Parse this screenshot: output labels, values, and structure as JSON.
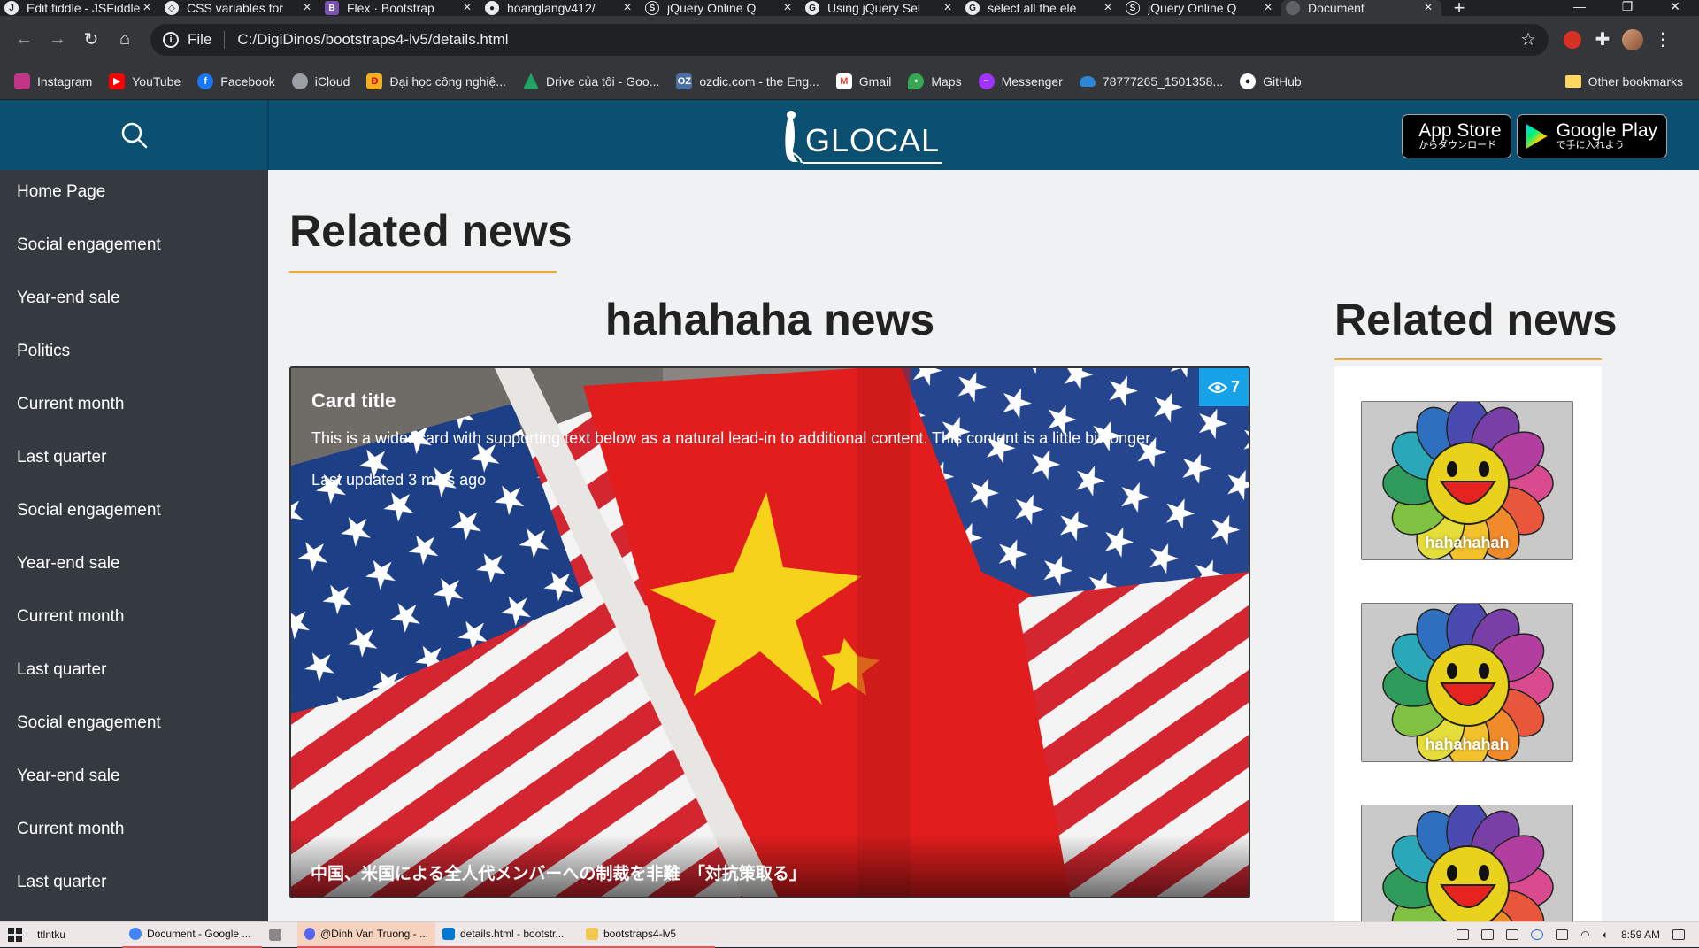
{
  "browser": {
    "tabs": [
      {
        "title": "Edit fiddle - JSFiddle",
        "icon": "jsfiddle-icon"
      },
      {
        "title": "CSS variables for",
        "icon": "codepen-icon"
      },
      {
        "title": "Flex · Bootstrap",
        "icon": "bootstrap-icon"
      },
      {
        "title": "hoanglangv412/",
        "icon": "github-icon"
      },
      {
        "title": "jQuery Online Q",
        "icon": "site-icon"
      },
      {
        "title": "Using jQuery Sel",
        "icon": "google-icon"
      },
      {
        "title": "select all the ele",
        "icon": "google-icon"
      },
      {
        "title": "jQuery Online Q",
        "icon": "site-icon"
      },
      {
        "title": "Document",
        "icon": "globe-icon",
        "active": true
      }
    ],
    "address": {
      "scheme": "File",
      "url": "C:/DigiDinos/bootstraps4-lv5/details.html"
    },
    "bookmarks": [
      {
        "label": "Instagram",
        "color": "#c13584"
      },
      {
        "label": "YouTube",
        "color": "#ff0000"
      },
      {
        "label": "Facebook",
        "color": "#1877f2"
      },
      {
        "label": "iCloud",
        "color": "#9aa0a6"
      },
      {
        "label": "Đại học công nghiệ...",
        "color": "#f2b01e"
      },
      {
        "label": "Drive của tôi - Goo...",
        "color": "#1fa463"
      },
      {
        "label": "ozdic.com - the Eng...",
        "color": "#4a6fa5"
      },
      {
        "label": "Gmail",
        "color": "#ea4335"
      },
      {
        "label": "Maps",
        "color": "#34a853"
      },
      {
        "label": "Messenger",
        "color": "#a033ff"
      },
      {
        "label": "78777265_1501358...",
        "color": "#2b88d8"
      },
      {
        "label": "GitHub",
        "color": "#ffffff"
      }
    ],
    "other_bookmarks": "Other bookmarks"
  },
  "site": {
    "logo_text": "GLOCAL",
    "app_store": {
      "big": "App Store",
      "small": "からダウンロード"
    },
    "google_play": {
      "big": "Google Play",
      "small": "で手に入れよう"
    }
  },
  "sidebar": {
    "items": [
      "Home Page",
      "Social engagement",
      "Year-end sale",
      "Politics",
      "Current month",
      "Last quarter",
      "Social engagement",
      "Year-end sale",
      "Current month",
      "Last quarter",
      "Social engagement",
      "Year-end sale",
      "Current month",
      "Last quarter"
    ]
  },
  "main": {
    "section_title": "Related news",
    "news_title": "hahahaha news",
    "card": {
      "title": "Card title",
      "text": "This is a wider card with supporting text below as a natural lead-in to additional content. This content is a little bit longer.",
      "updated": "Last updated 3 mins ago",
      "views": "7",
      "caption": "中国、米国による全人代メンバーへの制裁を非難　「対抗策取る」"
    },
    "side_title": "Related news",
    "thumbs": [
      {
        "caption": "hahahahah"
      },
      {
        "caption": "hahahahah"
      },
      {
        "caption": ""
      }
    ]
  },
  "taskbar": {
    "items": [
      {
        "label": "ttlntku",
        "color": "#ffffff"
      },
      {
        "label": "Document - Google ...",
        "color": "#4285f4"
      },
      {
        "label": "",
        "color": "#888888"
      },
      {
        "label": "@Dinh Van Truong - ...",
        "color": "#5865f2"
      },
      {
        "label": "details.html - bootstr...",
        "color": "#0078d4"
      },
      {
        "label": "bootstraps4-lv5",
        "color": "#f2c94c"
      }
    ],
    "time": "8:59 AM"
  }
}
